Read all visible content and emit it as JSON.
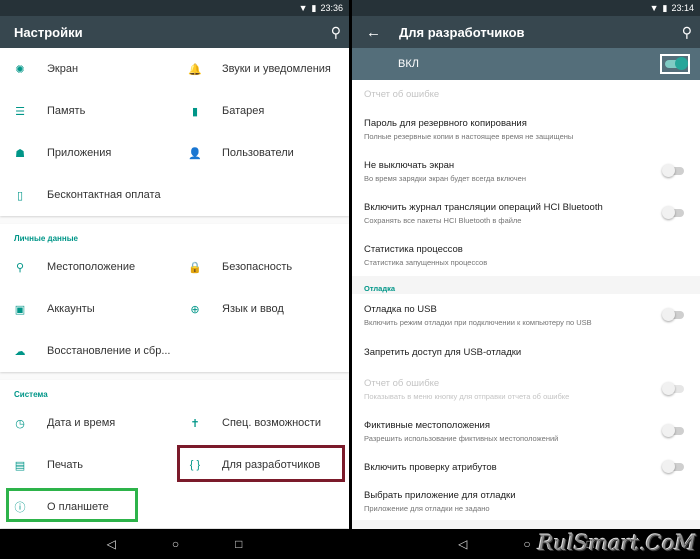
{
  "left": {
    "status_time": "23:36",
    "title": "Настройки",
    "device_tiles": [
      {
        "label": "Экран",
        "icon": "brightness-icon",
        "glyph": "✺"
      },
      {
        "label": "Звуки и уведомления",
        "icon": "bell-icon",
        "glyph": "🔔"
      },
      {
        "label": "Память",
        "icon": "storage-icon",
        "glyph": "☰"
      },
      {
        "label": "Батарея",
        "icon": "battery-icon",
        "glyph": "▮"
      },
      {
        "label": "Приложения",
        "icon": "android-icon",
        "glyph": "☗"
      },
      {
        "label": "Пользователи",
        "icon": "person-icon",
        "glyph": "👤"
      },
      {
        "label": "Бесконтактная оплата",
        "icon": "nfc-payment-icon",
        "glyph": "▯"
      }
    ],
    "personal_title": "Личные данные",
    "personal_tiles": [
      {
        "label": "Местоположение",
        "icon": "location-icon",
        "glyph": "⚲"
      },
      {
        "label": "Безопасность",
        "icon": "lock-icon",
        "glyph": "🔒"
      },
      {
        "label": "Аккаунты",
        "icon": "account-icon",
        "glyph": "▣"
      },
      {
        "label": "Язык и ввод",
        "icon": "globe-icon",
        "glyph": "⊕"
      },
      {
        "label": "Восстановление и сбр...",
        "icon": "cloud-backup-icon",
        "glyph": "☁"
      }
    ],
    "system_title": "Система",
    "system_tiles": [
      {
        "label": "Дата и время",
        "icon": "clock-icon",
        "glyph": "◷"
      },
      {
        "label": "Спец. возможности",
        "icon": "accessibility-icon",
        "glyph": "✝"
      },
      {
        "label": "Печать",
        "icon": "printer-icon",
        "glyph": "▤"
      },
      {
        "label": "Для разработчиков",
        "icon": "code-braces-icon",
        "glyph": "{ }"
      },
      {
        "label": "О планшете",
        "icon": "info-icon",
        "glyph": "ⓘ"
      }
    ]
  },
  "right": {
    "status_time": "23:14",
    "title": "Для разработчиков",
    "master_switch_label": "ВКЛ",
    "accent": "#009688",
    "rows_top": [
      {
        "title": "Отчет об ошибке",
        "sub": "",
        "toggle": false,
        "disabled": true,
        "h": 28
      },
      {
        "title": "Пароль для резервного копирования",
        "sub": "Полные резервные копии в настоящее время не защищены",
        "toggle": false,
        "disabled": false,
        "h": 42
      },
      {
        "title": "Не выключать экран",
        "sub": "Во время зарядки экран будет всегда включен",
        "toggle": true,
        "disabled": false,
        "h": 42
      },
      {
        "title": "Включить журнал трансляции операций HCI Bluetooth",
        "sub": "Сохранять все пакеты HCI Bluetooth в файле",
        "toggle": true,
        "disabled": false,
        "h": 42
      },
      {
        "title": "Статистика процессов",
        "sub": "Статистика запущенных процессов",
        "toggle": false,
        "disabled": false,
        "h": 42
      }
    ],
    "debug_title": "Отладка",
    "rows_debug": [
      {
        "title": "Отладка по USB",
        "sub": "Включить режим отладки при подключении к компьютеру по USB",
        "toggle": true,
        "disabled": false,
        "h": 42
      },
      {
        "title": "Запретить доступ для USB-отладки",
        "sub": "",
        "toggle": false,
        "disabled": false,
        "h": 32
      },
      {
        "title": "Отчет об ошибке",
        "sub": "Показывать в меню кнопку для отправки отчета об ошибке",
        "toggle": true,
        "disabled": true,
        "h": 42
      },
      {
        "title": "Фиктивные местоположения",
        "sub": "Разрешить использование фиктивных местоположений",
        "toggle": true,
        "disabled": false,
        "h": 42
      },
      {
        "title": "Включить проверку атрибутов",
        "sub": "",
        "toggle": true,
        "disabled": false,
        "h": 30
      },
      {
        "title": "Выбрать приложение для отладки",
        "sub": "Приложение для отладки не задано",
        "toggle": false,
        "disabled": false,
        "h": 38
      }
    ]
  },
  "nav": {
    "back": "◁",
    "home": "○",
    "recents": "□"
  },
  "watermark": "RulSmart.CoM"
}
